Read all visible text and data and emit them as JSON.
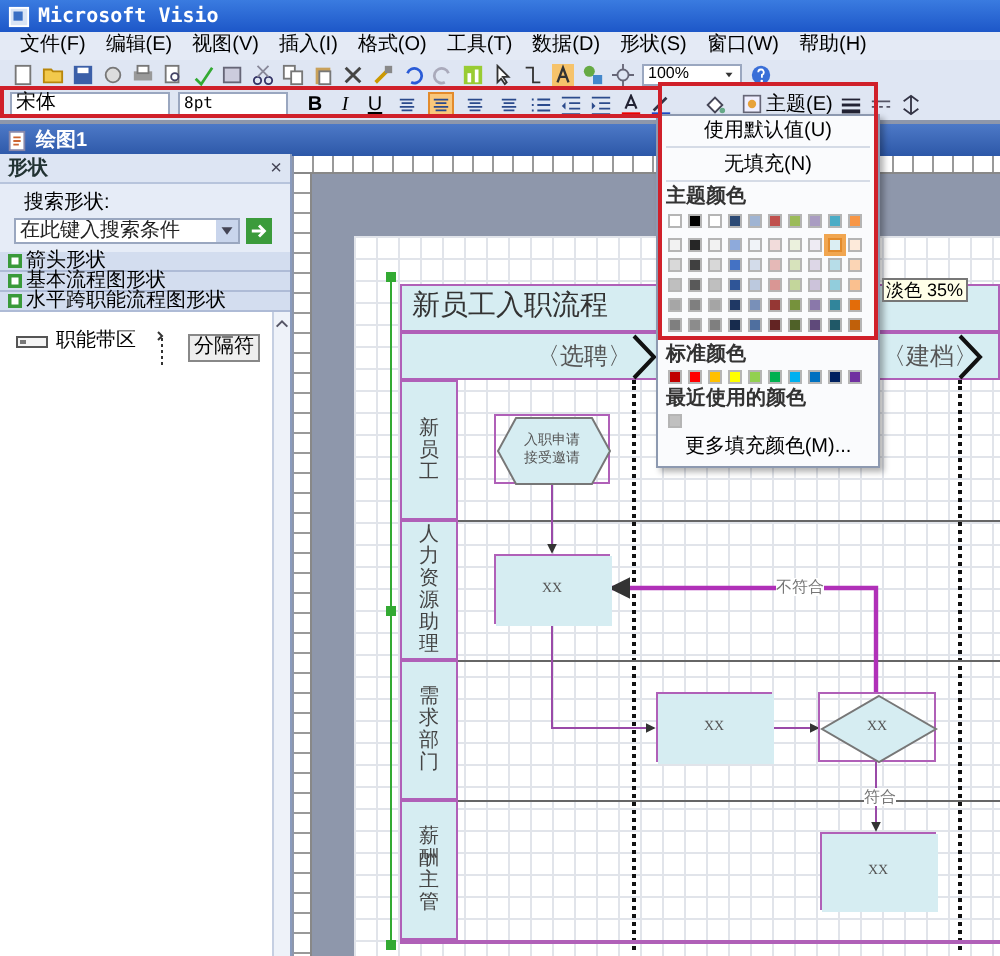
{
  "window": {
    "title": "Microsoft Visio"
  },
  "menu": [
    "文件(F)",
    "编辑(E)",
    "视图(V)",
    "插入(I)",
    "格式(O)",
    "工具(T)",
    "数据(D)",
    "形状(S)",
    "窗口(W)",
    "帮助(H)"
  ],
  "standard_toolbar": {
    "zoom": "100%"
  },
  "formatting_toolbar": {
    "font": "宋体",
    "size": "8pt",
    "style_buttons": [
      "B",
      "I",
      "U"
    ],
    "align_buttons": [
      {
        "selected": false
      },
      {
        "selected": true
      },
      {
        "selected": false
      },
      {
        "selected": false
      }
    ],
    "theme_button": "主题(E)"
  },
  "document": {
    "title": "绘图1"
  },
  "shapes_panel": {
    "title": "形状",
    "close_button": "×",
    "search_label": "搜索形状:",
    "search_placeholder": "在此键入搜索条件",
    "stencils": [
      "箭头形状",
      "基本流程图形状",
      "水平跨职能流程图形状"
    ],
    "shapes": [
      {
        "kind": "band",
        "label": "职能带区"
      },
      {
        "kind": "separator",
        "label": "分隔符"
      }
    ]
  },
  "diagram": {
    "title": "新员工入职流程",
    "phases": [
      "〈选聘〉",
      "〈建档〉"
    ],
    "lanes": [
      "新员工",
      "人力资源助理",
      "需求部门",
      "薪酬主管"
    ],
    "nodes": [
      {
        "kind": "hexagon",
        "lines": [
          "入职申请",
          "接受邀请"
        ]
      },
      {
        "kind": "process",
        "lines": [
          "XX"
        ]
      },
      {
        "kind": "process",
        "lines": [
          "XX"
        ]
      },
      {
        "kind": "decision",
        "lines": [
          "XX"
        ]
      },
      {
        "kind": "process",
        "lines": [
          "XX"
        ]
      }
    ],
    "connector_labels": [
      "不符合",
      "符合"
    ]
  },
  "fill_menu": {
    "default_item": "使用默认值(U)",
    "no_fill_item": "无填充(N)",
    "theme_heading": "主题颜色",
    "theme_rows": [
      {
        "colors": [
          {
            "color": "#ffffff",
            "selected": false
          },
          {
            "color": "#000000",
            "selected": false
          },
          {
            "color": "#ffffff",
            "selected": false
          },
          {
            "color": "#2c4a75",
            "selected": false
          },
          {
            "color": "#9fb4d3",
            "selected": false
          },
          {
            "color": "#c0504d",
            "selected": false
          },
          {
            "color": "#9bbb59",
            "selected": false
          },
          {
            "color": "#a99cc2",
            "selected": false
          },
          {
            "color": "#4bacc6",
            "selected": false
          },
          {
            "color": "#f79646",
            "selected": false
          }
        ]
      },
      {
        "colors": [
          {
            "color": "#f2f2f2",
            "selected": false
          },
          {
            "color": "#262626",
            "selected": false
          },
          {
            "color": "#f2f2f2",
            "selected": false
          },
          {
            "color": "#8eaadb",
            "selected": false
          },
          {
            "color": "#f0f3f8",
            "selected": false
          },
          {
            "color": "#f2dcdb",
            "selected": false
          },
          {
            "color": "#ebf1dd",
            "selected": false
          },
          {
            "color": "#eeebf3",
            "selected": false
          },
          {
            "color": "#dbeef3",
            "selected": true
          },
          {
            "color": "#fdeada",
            "selected": false
          }
        ]
      },
      {
        "colors": [
          {
            "color": "#d9d9d9",
            "selected": false
          },
          {
            "color": "#404040",
            "selected": false
          },
          {
            "color": "#d8d8d8",
            "selected": false
          },
          {
            "color": "#4472c4",
            "selected": false
          },
          {
            "color": "#d3dcea",
            "selected": false
          },
          {
            "color": "#e5b9b7",
            "selected": false
          },
          {
            "color": "#d7e3bc",
            "selected": false
          },
          {
            "color": "#ddd7e7",
            "selected": false
          },
          {
            "color": "#b7dde8",
            "selected": false
          },
          {
            "color": "#fbd5b5",
            "selected": false
          }
        ]
      },
      {
        "colors": [
          {
            "color": "#bfbfbf",
            "selected": false
          },
          {
            "color": "#595959",
            "selected": false
          },
          {
            "color": "#bfbfbf",
            "selected": false
          },
          {
            "color": "#2f5597",
            "selected": false
          },
          {
            "color": "#bcc9de",
            "selected": false
          },
          {
            "color": "#d99694",
            "selected": false
          },
          {
            "color": "#c3d69b",
            "selected": false
          },
          {
            "color": "#ccc3da",
            "selected": false
          },
          {
            "color": "#92cddc",
            "selected": false
          },
          {
            "color": "#fac08f",
            "selected": false
          }
        ]
      },
      {
        "colors": [
          {
            "color": "#a6a6a6",
            "selected": false
          },
          {
            "color": "#7f7f7f",
            "selected": false
          },
          {
            "color": "#a5a5a5",
            "selected": false
          },
          {
            "color": "#1f3864",
            "selected": false
          },
          {
            "color": "#7990b8",
            "selected": false
          },
          {
            "color": "#953734",
            "selected": false
          },
          {
            "color": "#76923c",
            "selected": false
          },
          {
            "color": "#8a78aa",
            "selected": false
          },
          {
            "color": "#31859b",
            "selected": false
          },
          {
            "color": "#e36c09",
            "selected": false
          }
        ]
      },
      {
        "colors": [
          {
            "color": "#7f7f7f",
            "selected": false
          },
          {
            "color": "#8c8c8c",
            "selected": false
          },
          {
            "color": "#7f7f7f",
            "selected": false
          },
          {
            "color": "#172b4d",
            "selected": false
          },
          {
            "color": "#4f6f9f",
            "selected": false
          },
          {
            "color": "#632423",
            "selected": false
          },
          {
            "color": "#4f6128",
            "selected": false
          },
          {
            "color": "#5f497a",
            "selected": false
          },
          {
            "color": "#205867",
            "selected": false
          },
          {
            "color": "#c0600a",
            "selected": false
          }
        ]
      }
    ],
    "tooltip": "淡色 35%",
    "standard_heading": "标准颜色",
    "standard_colors": [
      {
        "color": "#c00000"
      },
      {
        "color": "#ff0000"
      },
      {
        "color": "#ffc000"
      },
      {
        "color": "#ffff00"
      },
      {
        "color": "#92d050"
      },
      {
        "color": "#00b050"
      },
      {
        "color": "#00b0f0"
      },
      {
        "color": "#0070c0"
      },
      {
        "color": "#002060"
      },
      {
        "color": "#7030a0"
      }
    ],
    "recent_heading": "最近使用的颜色",
    "recent_colors": [
      {
        "color": "#c0c0c0"
      }
    ],
    "more_item": "更多填充颜色(M)..."
  }
}
